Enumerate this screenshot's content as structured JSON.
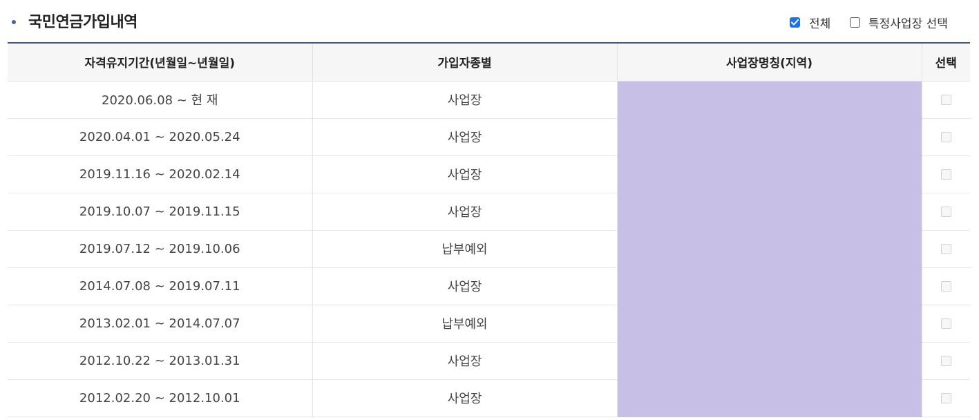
{
  "section": {
    "title": "국민연금가입내역"
  },
  "filters": {
    "all_label": "전체",
    "all_checked": true,
    "specific_label": "특정사업장 선택",
    "specific_checked": false
  },
  "table": {
    "headers": [
      "자격유지기간(년월일~년월일)",
      "가입자종별",
      "사업장명칭(지역)",
      "선택"
    ],
    "rows": [
      {
        "period": "2020.06.08 ~ 현 재",
        "type": "사업장",
        "workplace": ""
      },
      {
        "period": "2020.04.01 ~ 2020.05.24",
        "type": "사업장",
        "workplace": ""
      },
      {
        "period": "2019.11.16 ~ 2020.02.14",
        "type": "사업장",
        "workplace": ""
      },
      {
        "period": "2019.10.07 ~ 2019.11.15",
        "type": "사업장",
        "workplace": ""
      },
      {
        "period": "2019.07.12 ~ 2019.10.06",
        "type": "납부예외",
        "workplace": ""
      },
      {
        "period": "2014.07.08 ~ 2019.07.11",
        "type": "사업장",
        "workplace": ""
      },
      {
        "period": "2013.02.01 ~ 2014.07.07",
        "type": "납부예외",
        "workplace": ""
      },
      {
        "period": "2012.10.22 ~ 2013.01.31",
        "type": "사업장",
        "workplace": ""
      },
      {
        "period": "2012.02.20 ~ 2012.10.01",
        "type": "사업장",
        "workplace": ""
      }
    ]
  },
  "colors": {
    "accent": "#3d5196",
    "redaction": "#c7bfe5",
    "checkbox_checked": "#1a73e8"
  }
}
